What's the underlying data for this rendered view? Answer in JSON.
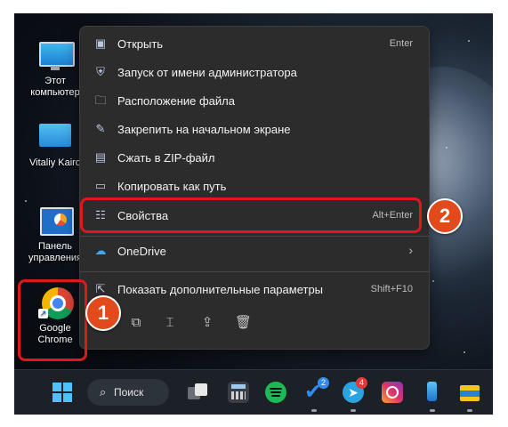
{
  "desktop": {
    "icons": [
      {
        "label": "Этот компьютер"
      },
      {
        "label": "Vitaliy Kairo"
      },
      {
        "label": "Панель управления"
      },
      {
        "label": "Google Chrome"
      }
    ]
  },
  "context_menu": {
    "items": [
      {
        "label": "Открыть",
        "shortcut": "Enter",
        "icon": "open-icon"
      },
      {
        "label": "Запуск от имени администратора",
        "shortcut": "",
        "icon": "shield-icon"
      },
      {
        "label": "Расположение файла",
        "shortcut": "",
        "icon": "folder-icon"
      },
      {
        "label": "Закрепить на начальном экране",
        "shortcut": "",
        "icon": "pin-icon"
      },
      {
        "label": "Сжать в ZIP-файл",
        "shortcut": "",
        "icon": "zip-icon"
      },
      {
        "label": "Копировать как путь",
        "shortcut": "",
        "icon": "copy-path-icon"
      },
      {
        "label": "Свойства",
        "shortcut": "Alt+Enter",
        "icon": "properties-icon"
      },
      {
        "label": "OneDrive",
        "shortcut": "",
        "icon": "onedrive-icon"
      },
      {
        "label": "Показать дополнительные параметры",
        "shortcut": "Shift+F10",
        "icon": "more-options-icon"
      }
    ],
    "bottom_actions": [
      "cut-icon",
      "copy-icon",
      "rename-icon",
      "share-icon",
      "delete-icon"
    ]
  },
  "annotations": {
    "step1": "1",
    "step2": "2",
    "color": "#e0171c"
  },
  "taskbar": {
    "search_label": "Поиск",
    "badges": {
      "telegram": "2",
      "messenger": "4"
    }
  }
}
